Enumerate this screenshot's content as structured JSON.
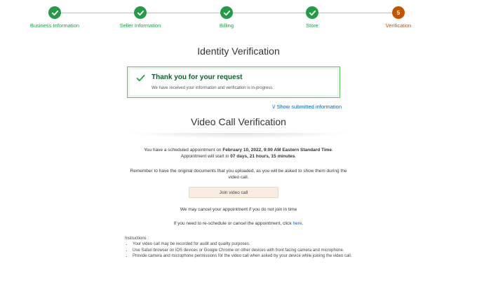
{
  "stepper": {
    "steps": [
      {
        "label": "Business Information",
        "state": "done"
      },
      {
        "label": "Seller Information",
        "state": "done"
      },
      {
        "label": "Billing",
        "state": "done"
      },
      {
        "label": "Store",
        "state": "done"
      },
      {
        "label": "Verification",
        "state": "current",
        "number": "5"
      }
    ],
    "done_color": "#239b48",
    "current_color": "#c45500"
  },
  "identity": {
    "title": "Identity Verification",
    "alert_title": "Thank you for your request",
    "alert_text": "We have received your information and verification is in-progress.",
    "show_link": "\\/ Show submitted information"
  },
  "video": {
    "title": "Video Call Verification",
    "scheduled_prefix": "You have a scheduled appointment on ",
    "scheduled_date": "February 10, 2022, 9:00 AM Eastern Standard Time",
    "scheduled_suffix": ".",
    "starts_prefix": "Appointment will start in ",
    "starts_in": "07 days, 21 hours, 15 minutes",
    "starts_suffix": ".",
    "remember_text": "Remember to have the original documents that you uploaded, as you will be asked to show them during the video call.",
    "join_button": "Join video call",
    "cancel_notice": "We may cancel your appointment if you do not join in time",
    "reschedule_prefix": "If you need to re-schedule or cancel the appointment, click ",
    "reschedule_link": "here",
    "reschedule_suffix": ".",
    "instructions_title": "Instructions :",
    "instructions": [
      "Your video call may be recorded for audit and quality purposes.",
      "Use Safari browser on iOS devices or Google Chrome on other devices with front facing camera and microphone.",
      "Provide camera and microphone permissions for the video call when asked by your device while joining the video call."
    ]
  }
}
